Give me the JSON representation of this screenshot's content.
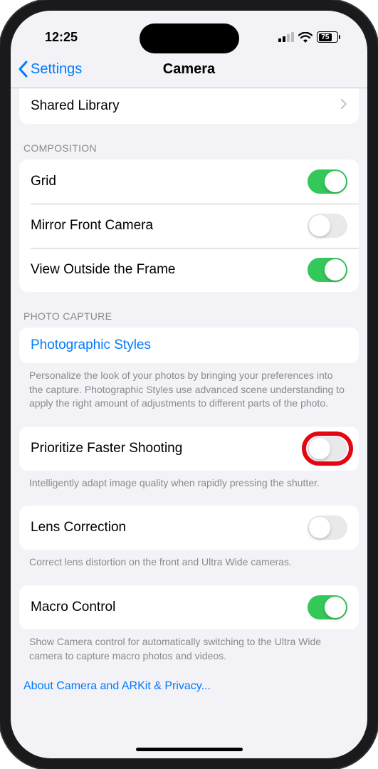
{
  "status_bar": {
    "time": "12:25",
    "battery_percent": "75"
  },
  "nav": {
    "back_label": "Settings",
    "title": "Camera"
  },
  "rows": {
    "shared_library": "Shared Library"
  },
  "sections": {
    "composition": {
      "header": "COMPOSITION",
      "grid": "Grid",
      "mirror_front": "Mirror Front Camera",
      "view_outside": "View Outside the Frame"
    },
    "photo_capture": {
      "header": "PHOTO CAPTURE",
      "photographic_styles": "Photographic Styles",
      "photographic_styles_footer": "Personalize the look of your photos by bringing your preferences into the capture. Photographic Styles use advanced scene understanding to apply the right amount of adjustments to different parts of the photo.",
      "prioritize_faster": "Prioritize Faster Shooting",
      "prioritize_faster_footer": "Intelligently adapt image quality when rapidly pressing the shutter.",
      "lens_correction": "Lens Correction",
      "lens_correction_footer": "Correct lens distortion on the front and Ultra Wide cameras.",
      "macro_control": "Macro Control",
      "macro_control_footer": "Show Camera control for automatically switching to the Ultra Wide camera to capture macro photos and videos."
    }
  },
  "toggles": {
    "grid": true,
    "mirror_front": false,
    "view_outside": true,
    "prioritize_faster": false,
    "lens_correction": false,
    "macro_control": true
  },
  "bottom_link": "About Camera and ARKit & Privacy..."
}
